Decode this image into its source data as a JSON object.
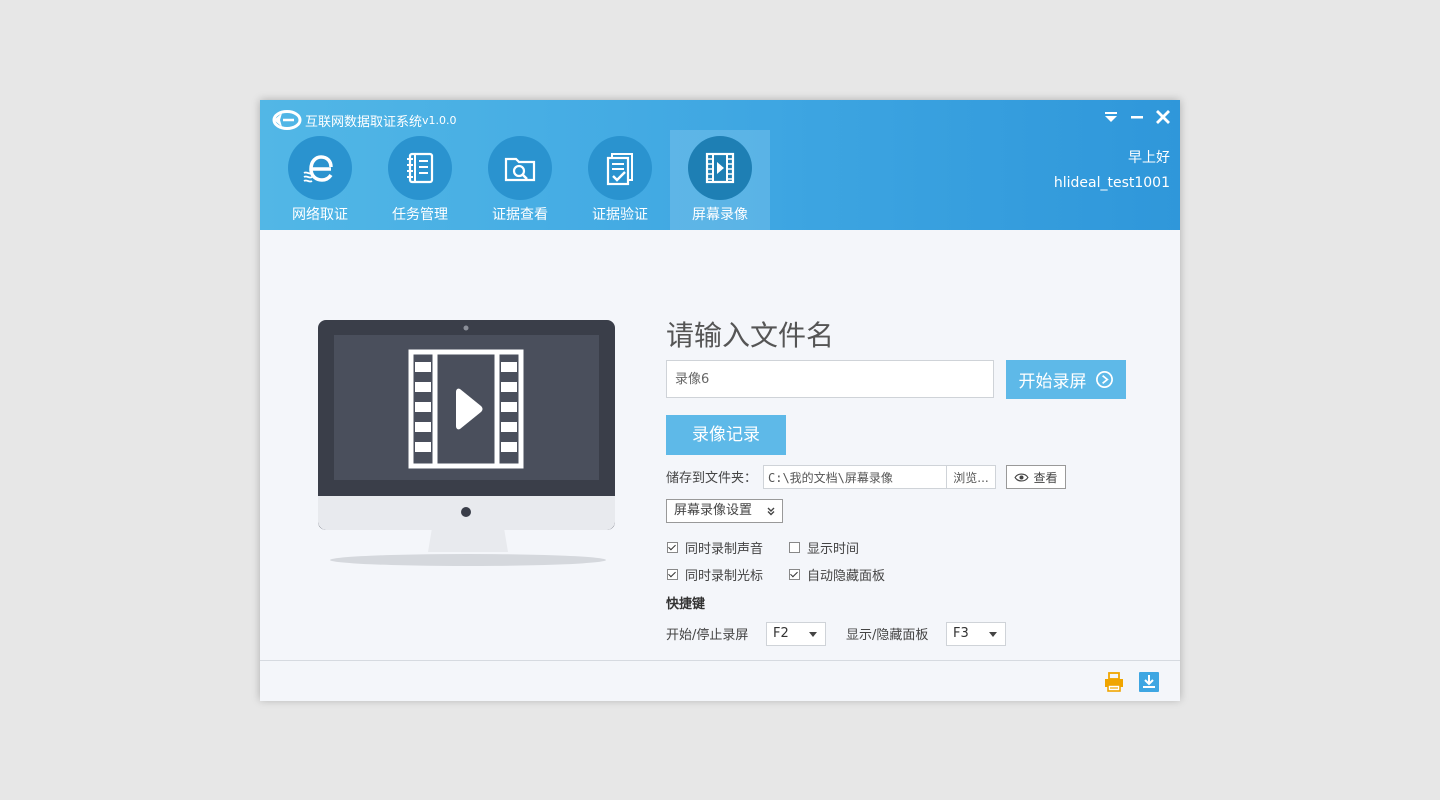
{
  "app": {
    "title": "互联网数据取证系统",
    "version": "v1.0.0"
  },
  "nav": [
    {
      "label": "网络取证",
      "icon": "web-evidence-icon",
      "active": false
    },
    {
      "label": "任务管理",
      "icon": "notebook-icon",
      "active": false
    },
    {
      "label": "证据查看",
      "icon": "folder-search-icon",
      "active": false
    },
    {
      "label": "证据验证",
      "icon": "document-check-icon",
      "active": false
    },
    {
      "label": "屏幕录像",
      "icon": "film-play-icon",
      "active": true
    }
  ],
  "user": {
    "greeting": "早上好",
    "name": "hlideal_test1001"
  },
  "form": {
    "heading": "请输入文件名",
    "filename_value": "录像6",
    "start_label": "开始录屏",
    "records_label": "录像记录",
    "save_label": "储存到文件夹：",
    "save_path": "C:\\我的文档\\屏幕录像",
    "browse_label": "浏览...",
    "view_label": "查看",
    "settings_label": "屏幕录像设置"
  },
  "options": [
    {
      "label": "同时录制声音",
      "checked": true
    },
    {
      "label": "显示时间",
      "checked": false
    },
    {
      "label": "同时录制光标",
      "checked": true
    },
    {
      "label": "自动隐藏面板",
      "checked": true
    }
  ],
  "hotkeys": {
    "title": "快捷键",
    "start_stop_label": "开始/停止录屏",
    "start_stop_key": "F2",
    "toggle_panel_label": "显示/隐藏面板",
    "toggle_panel_key": "F3"
  },
  "colors": {
    "header": "#3ea6e2",
    "accent_button": "#5eb9e8",
    "nav_circle": "#2a93cf",
    "print_icon": "#f0a500"
  },
  "footer_icons": [
    "print-icon",
    "download-icon"
  ]
}
